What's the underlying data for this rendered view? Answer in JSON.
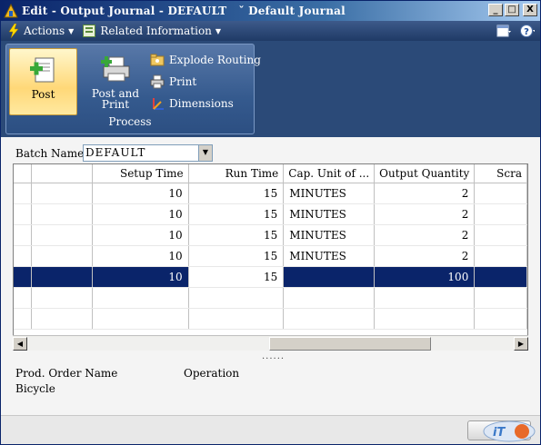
{
  "window": {
    "title": "Edit - Output Journal - DEFAULT   ˇ Default Journal",
    "buttons": {
      "minimize": "_",
      "maximize": "□",
      "close": "X"
    }
  },
  "action_strip": {
    "actions_label": "Actions",
    "related_label": "Related Information"
  },
  "ribbon": {
    "post_label": "Post",
    "post_print_label": "Post and Print",
    "explode_routing_label": "Explode Routing",
    "print_label": "Print",
    "dimensions_label": "Dimensions",
    "group_label": "Process"
  },
  "batch": {
    "label": "Batch Name:",
    "value": "DEFAULT"
  },
  "grid": {
    "columns": [
      "",
      "Setup Time",
      "Run Time",
      "Cap. Unit of ...",
      "Output Quantity",
      "Scra"
    ],
    "rows": [
      {
        "setup": "10",
        "run": "15",
        "cap": "MINUTES",
        "output": "2"
      },
      {
        "setup": "10",
        "run": "15",
        "cap": "MINUTES",
        "output": "2"
      },
      {
        "setup": "10",
        "run": "15",
        "cap": "MINUTES",
        "output": "2"
      },
      {
        "setup": "10",
        "run": "15",
        "cap": "MINUTES",
        "output": "2"
      },
      {
        "setup": "10",
        "run": "15",
        "cap": "",
        "output": "100"
      }
    ],
    "selected_row": 5
  },
  "factbox": {
    "prod_order_name_label": "Prod. Order Name",
    "operation_label": "Operation",
    "prod_order_name_value": "Bicycle"
  },
  "splitter_text": "......",
  "colors": {
    "selection": "#0a246a",
    "ribbon": "#2b4a78",
    "title_start": "#0a246a"
  }
}
